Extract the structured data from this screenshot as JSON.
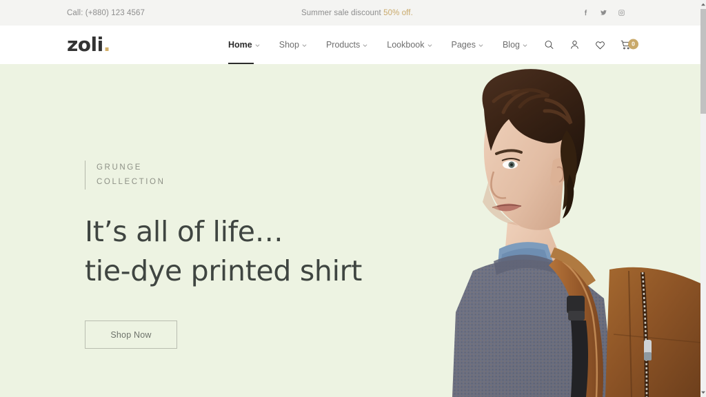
{
  "topbar": {
    "call": "Call: (+880) 123 4567",
    "promo_text": "Summer sale discount ",
    "promo_accent": "50% off.",
    "social": [
      {
        "name": "facebook-icon",
        "label": "Facebook"
      },
      {
        "name": "twitter-icon",
        "label": "Twitter"
      },
      {
        "name": "instagram-icon",
        "label": "Instagram"
      }
    ]
  },
  "header": {
    "logo_text": "zoli",
    "logo_dot": ".",
    "nav": [
      {
        "label": "Home",
        "active": true,
        "has_dropdown": true
      },
      {
        "label": "Shop",
        "active": false,
        "has_dropdown": true
      },
      {
        "label": "Products",
        "active": false,
        "has_dropdown": true
      },
      {
        "label": "Lookbook",
        "active": false,
        "has_dropdown": true
      },
      {
        "label": "Pages",
        "active": false,
        "has_dropdown": true
      },
      {
        "label": "Blog",
        "active": false,
        "has_dropdown": true
      }
    ],
    "icons": [
      {
        "name": "search-icon",
        "label": "Search"
      },
      {
        "name": "user-account-icon",
        "label": "Account"
      },
      {
        "name": "wishlist-heart-icon",
        "label": "Wishlist"
      },
      {
        "name": "shopping-cart-icon",
        "label": "Cart"
      }
    ],
    "cart_count": "0"
  },
  "hero": {
    "eyebrow_line1": "Grunge",
    "eyebrow_line2": "Collection",
    "headline_line1": "It’s all of life…",
    "headline_line2": "tie-dye printed shirt",
    "cta_label": "Shop Now",
    "image_alt": "Young male model with curly brown hair wearing a denim collar shirt, blue-grey knit sweater and a tan leather backpack"
  },
  "colors": {
    "hero_background": "#edf3e2",
    "topbar_background": "#f4f4f2",
    "accent_gold": "#c9a96a",
    "headline": "#3f4541",
    "nav_inactive": "#6e6e6e",
    "nav_active": "#2b2b2b"
  },
  "scrollbar": {
    "name": "page-scrollbar",
    "up_arrow": "scroll-up-arrow",
    "down_arrow": "scroll-down-arrow"
  }
}
